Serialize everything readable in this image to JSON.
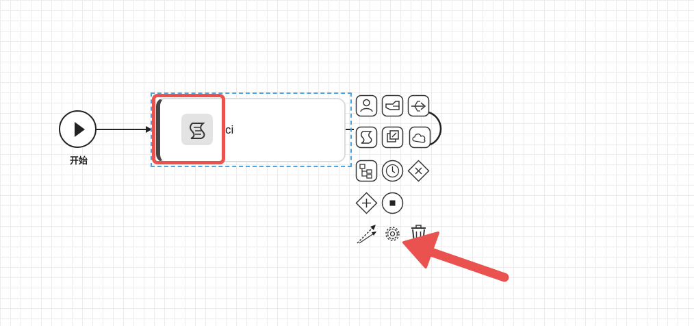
{
  "canvas": {
    "start_event": {
      "label": "开始"
    },
    "task": {
      "name": "ci",
      "icon": "script-icon"
    }
  },
  "context_pad": {
    "items": [
      {
        "name": "user-task-icon",
        "kind": "append"
      },
      {
        "name": "manual-task-icon",
        "kind": "append"
      },
      {
        "name": "service-task-icon",
        "kind": "append"
      },
      {
        "name": "script-task-icon",
        "kind": "append"
      },
      {
        "name": "subprocess-icon",
        "kind": "append"
      },
      {
        "name": "cloud-task-icon",
        "kind": "append"
      },
      {
        "name": "org-task-icon",
        "kind": "append"
      },
      {
        "name": "timer-event-icon",
        "kind": "append"
      },
      {
        "name": "exclusive-gateway-icon",
        "kind": "append"
      },
      {
        "name": "parallel-gateway-icon",
        "kind": "append"
      },
      {
        "name": "end-event-icon",
        "kind": "append"
      },
      {
        "name": "connect-icon",
        "kind": "tool"
      },
      {
        "name": "gear-icon",
        "kind": "tool"
      },
      {
        "name": "trash-icon",
        "kind": "tool"
      }
    ]
  },
  "annotation": {
    "highlight_color": "#e9524f",
    "arrow_color": "#e9524f"
  }
}
